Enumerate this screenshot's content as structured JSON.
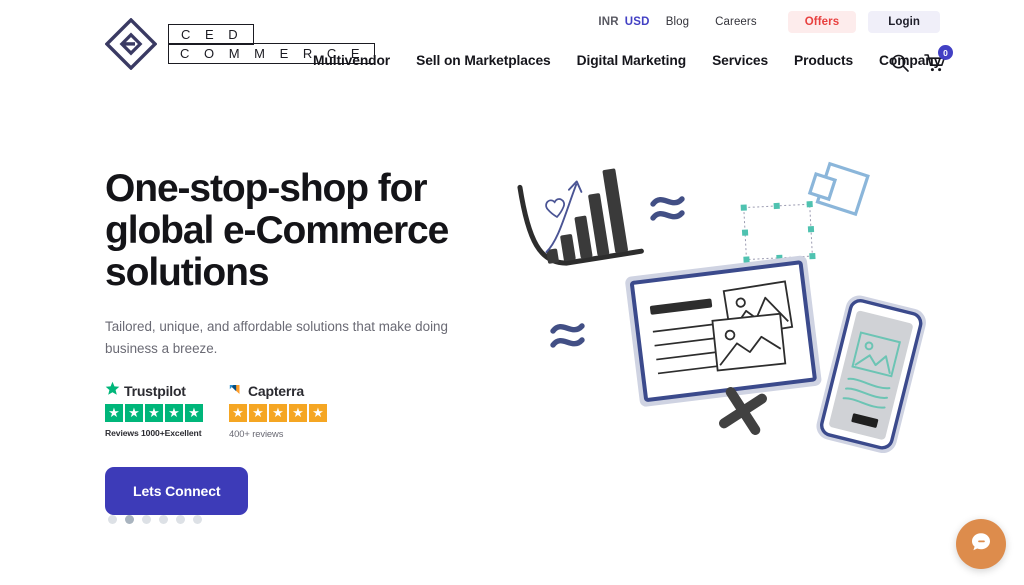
{
  "brand": {
    "logo_line1": "C E D",
    "logo_line2": "C O M M E R C E",
    "accent_color": "#4240c4",
    "cta_color": "#3d3bb8"
  },
  "topbar": {
    "currency_inr": "INR",
    "currency_usd": "USD",
    "links": [
      {
        "label": "Blog"
      },
      {
        "label": "Careers"
      }
    ],
    "offers_label": "Offers",
    "login_label": "Login",
    "offers_color": "#e8403f"
  },
  "mainnav": {
    "items": [
      {
        "label": "Multivendor"
      },
      {
        "label": "Sell on Marketplaces"
      },
      {
        "label": "Digital Marketing"
      },
      {
        "label": "Services"
      },
      {
        "label": "Products"
      },
      {
        "label": "Company"
      }
    ],
    "search_icon": "search-icon",
    "cart_icon": "cart-icon",
    "cart_count": "0"
  },
  "hero": {
    "title": "One-stop-shop for global e-Commerce solutions",
    "subtitle": "Tailored, unique, and affordable solutions that make doing business a breeze.",
    "cta_label": "Lets Connect"
  },
  "reviews": [
    {
      "name": "Trustpilot",
      "stars": 5,
      "star_color": "#00b67a",
      "caption": "Reviews 1000+Excellent"
    },
    {
      "name": "Capterra",
      "stars": 5,
      "star_color": "#f5a623",
      "caption": "400+ reviews"
    }
  ],
  "carousel": {
    "total_dots": 6,
    "active_index": 1
  },
  "illustration": {
    "alt": "hand-drawn e-commerce illustration with bar chart, website card, selection frame and mobile mockup"
  },
  "chat": {
    "icon": "chat-bubble-icon",
    "color": "#dd8c4c"
  }
}
